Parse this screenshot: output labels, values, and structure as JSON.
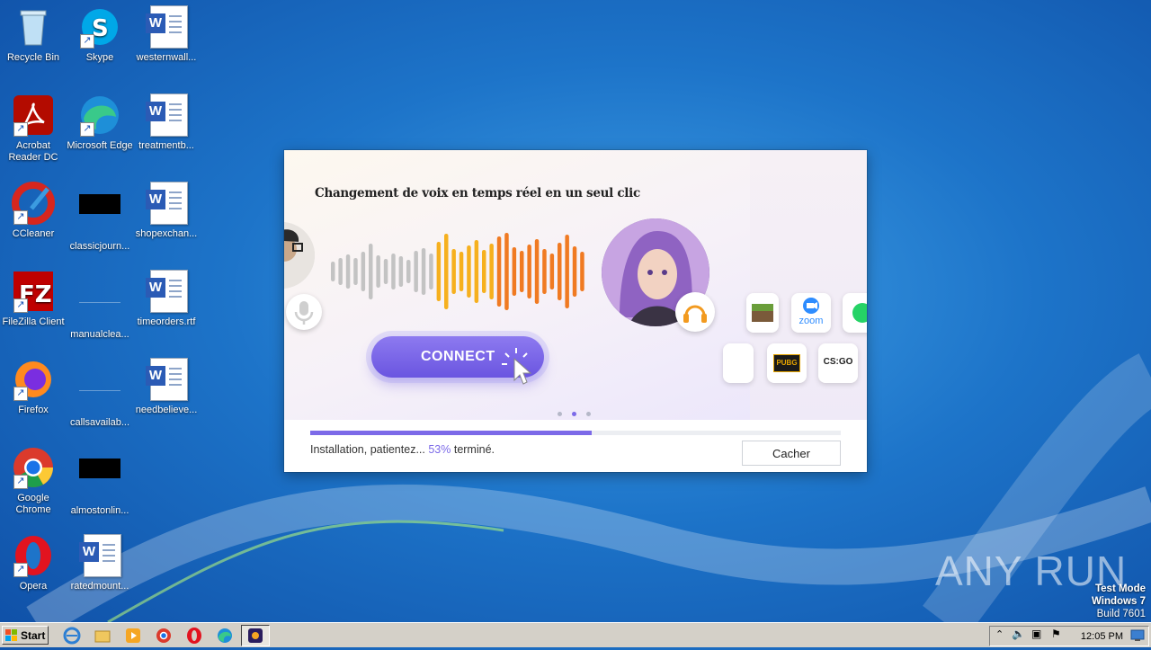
{
  "desktop_icons": [
    {
      "label": "Recycle Bin"
    },
    {
      "label": "Skype"
    },
    {
      "label": "westernwall..."
    },
    {
      "label": "Acrobat Reader DC"
    },
    {
      "label": "Microsoft Edge"
    },
    {
      "label": "treatmentb..."
    },
    {
      "label": "CCleaner"
    },
    {
      "label": "classicjourn..."
    },
    {
      "label": "shopexchan..."
    },
    {
      "label": "FileZilla Client"
    },
    {
      "label": "manualclea..."
    },
    {
      "label": "timeorders.rtf"
    },
    {
      "label": "Firefox"
    },
    {
      "label": "callsavailab..."
    },
    {
      "label": "needbelieve..."
    },
    {
      "label": "Google Chrome"
    },
    {
      "label": "almostonlin..."
    },
    {
      "label": "Opera"
    },
    {
      "label": "ratedmount..."
    }
  ],
  "installer": {
    "headline": "Changement de voix en temps réel en un seul clic",
    "connect_label": "CONNECT",
    "app_tiles": [
      {
        "label": "zoom"
      },
      {
        "label": "PUBG"
      },
      {
        "label": "CS:GO"
      }
    ],
    "carousel": {
      "count": 3,
      "active": 1
    },
    "progress": {
      "percent": 53,
      "status_prefix": "Installation, patientez... ",
      "percent_text": "53%",
      "status_suffix": " terminé."
    },
    "hide_label": "Cacher",
    "accent": "#7c6ae8"
  },
  "watermark": {
    "text": "ANY RUN"
  },
  "system_info": {
    "line1": "Test Mode",
    "line2": "Windows 7",
    "line3": "Build 7601"
  },
  "taskbar": {
    "start_label": "Start",
    "clock": "12:05 PM",
    "pinned": [
      "internet-explorer-icon",
      "explorer-folder-icon",
      "media-player-icon",
      "chrome-icon",
      "opera-icon",
      "edge-icon",
      "installer-app-icon"
    ]
  }
}
